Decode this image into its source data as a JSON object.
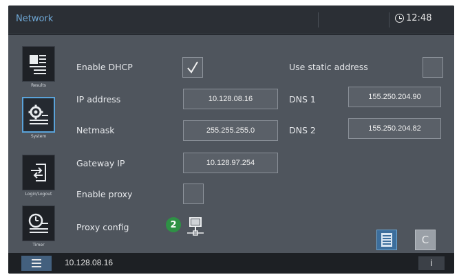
{
  "header": {
    "title": "Network",
    "time": "12:48"
  },
  "sidebar": {
    "items": [
      {
        "label": "Results",
        "icon": "results-icon"
      },
      {
        "label": "System",
        "icon": "system-icon"
      },
      {
        "label": "Login/Logout",
        "icon": "login-logout-icon"
      },
      {
        "label": "Timer",
        "icon": "timer-icon"
      }
    ]
  },
  "form": {
    "enable_dhcp_label": "Enable DHCP",
    "enable_dhcp_checked": true,
    "use_static_label": "Use static address",
    "use_static_checked": false,
    "ip_label": "IP address",
    "ip_value": "10.128.08.16",
    "dns1_label": "DNS 1",
    "dns1_value": "155.250.204.90",
    "netmask_label": "Netmask",
    "netmask_value": "255.255.255.0",
    "dns2_label": "DNS 2",
    "dns2_value": "155.250.204.82",
    "gateway_label": "Gateway IP",
    "gateway_value": "10.128.97.254",
    "enable_proxy_label": "Enable proxy",
    "enable_proxy_checked": false,
    "proxy_config_label": "Proxy config",
    "callout_number": "2"
  },
  "actions": {
    "clear_label": "C"
  },
  "statusbar": {
    "ip": "10.128.08.16",
    "info_label": "i"
  },
  "colors": {
    "accent": "#5aa3da",
    "title": "#6fa8d6",
    "callout": "#2e9145",
    "save_button": "#3c6e9c"
  }
}
